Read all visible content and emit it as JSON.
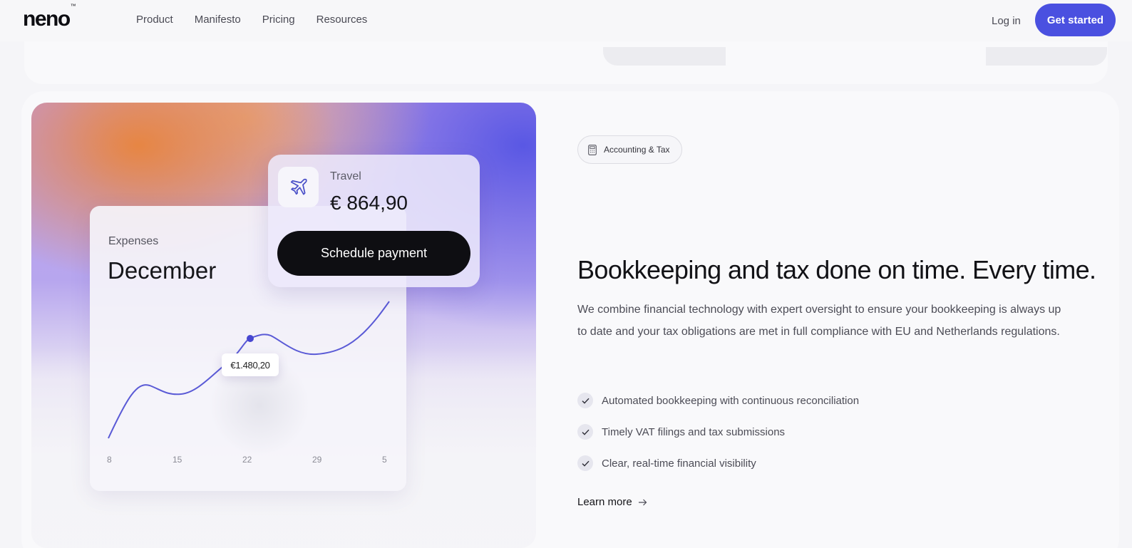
{
  "nav": {
    "logo": "neno",
    "logo_mark": "™",
    "links": [
      "Product",
      "Manifesto",
      "Pricing",
      "Resources"
    ],
    "login": "Log in",
    "cta": "Get started",
    "cta_color": "#4a50e0"
  },
  "visual": {
    "expenses": {
      "label": "Expenses",
      "month": "December",
      "tooltip_value": "€1.480,20",
      "x_ticks": [
        "8",
        "15",
        "22",
        "29",
        "5"
      ],
      "line_color": "#5a5ad6"
    },
    "travel": {
      "icon": "airplane-icon",
      "label": "Travel",
      "amount": "€ 864,90",
      "button": "Schedule payment"
    }
  },
  "content": {
    "badge_icon": "calculator-icon",
    "badge": "Accounting & Tax",
    "headline": "Bookkeeping and tax done on time. Every time.",
    "description": "We combine financial technology with expert oversight to ensure your bookkeeping is always up to date and your tax obligations are met in full compliance with EU and Netherlands regulations.",
    "features": [
      "Automated bookkeeping with continuous reconciliation",
      "Timely VAT filings and tax submissions",
      "Clear, real-time financial visibility"
    ],
    "learn_more": "Learn more",
    "learn_more_icon": "arrow-right-icon"
  }
}
